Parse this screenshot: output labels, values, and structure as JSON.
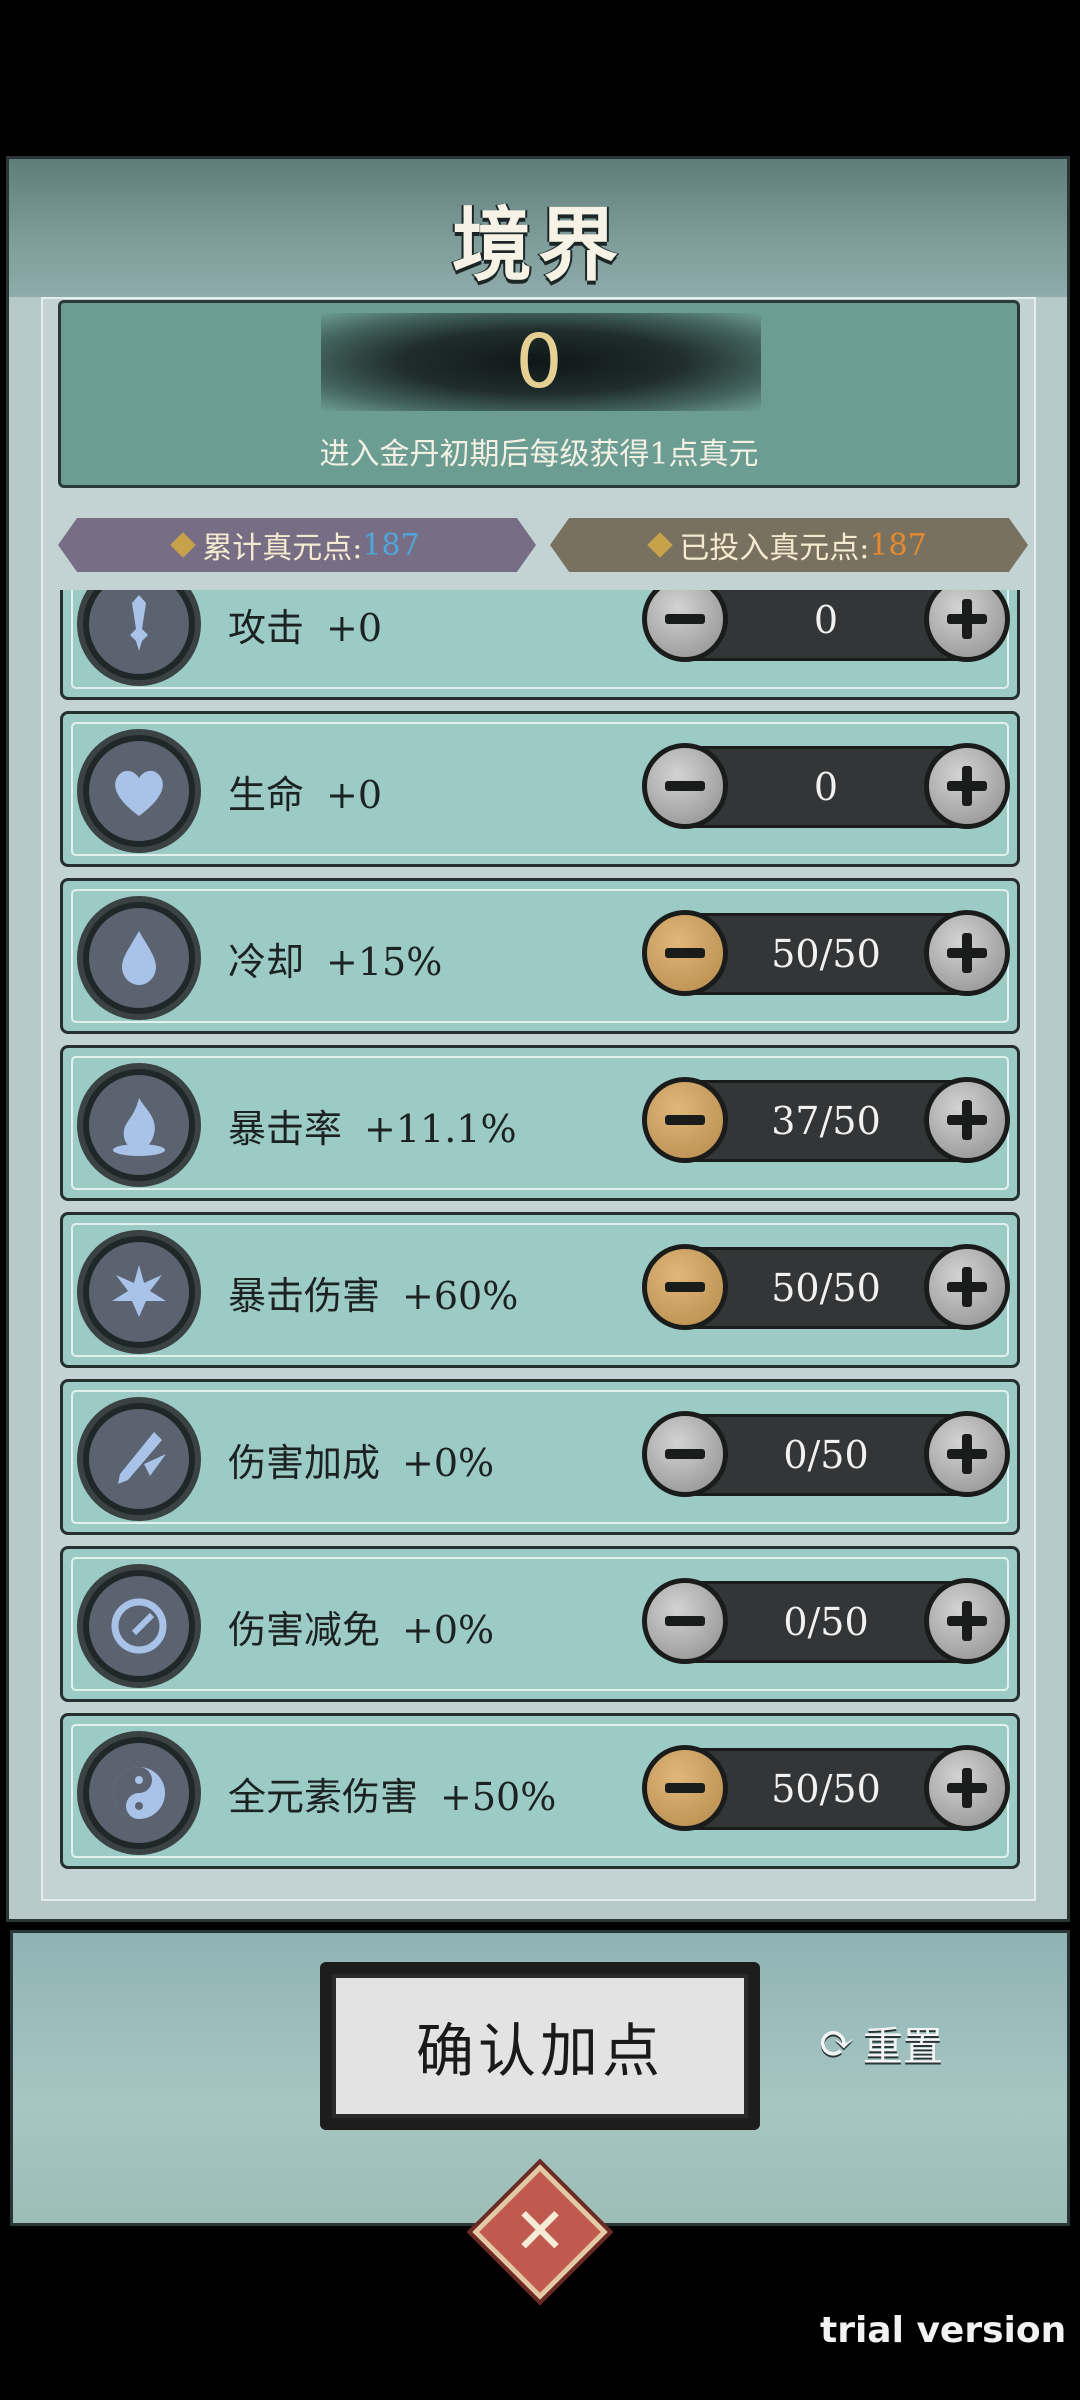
{
  "panel": {
    "title": "境界",
    "points_value": "0",
    "points_hint": "进入金丹初期后每级获得1点真元"
  },
  "tags": {
    "total_label": "累计真元点:",
    "total_value": "187",
    "invested_label": "已投入真元点:",
    "invested_value": "187"
  },
  "stats": [
    {
      "name": "攻击",
      "bonus": "+0",
      "value": "0",
      "minus_active": false,
      "icon": "sword-icon"
    },
    {
      "name": "生命",
      "bonus": "+0",
      "value": "0",
      "minus_active": false,
      "icon": "heart-icon"
    },
    {
      "name": "冷却",
      "bonus": "+15%",
      "value": "50/50",
      "minus_active": true,
      "icon": "water-drop-icon"
    },
    {
      "name": "暴击率",
      "bonus": "+11.1%",
      "value": "37/50",
      "minus_active": true,
      "icon": "flame-icon"
    },
    {
      "name": "暴击伤害",
      "bonus": "+60%",
      "value": "50/50",
      "minus_active": true,
      "icon": "burst-icon"
    },
    {
      "name": "伤害加成",
      "bonus": "+0%",
      "value": "0/50",
      "minus_active": false,
      "icon": "slash-sword-icon"
    },
    {
      "name": "伤害减免",
      "bonus": "+0%",
      "value": "0/50",
      "minus_active": false,
      "icon": "shield-ring-icon"
    },
    {
      "name": "全元素伤害",
      "bonus": "+50%",
      "value": "50/50",
      "minus_active": true,
      "icon": "yin-yang-icon"
    }
  ],
  "footer": {
    "confirm_label": "确认加点",
    "reset_label": "重置"
  },
  "watermark": "trial version",
  "colors": {
    "total_value": "#4fa6d8",
    "invested_value": "#e58a2e",
    "minus_active": "#c99a5d",
    "minus_inactive": "#a8a8a8"
  }
}
